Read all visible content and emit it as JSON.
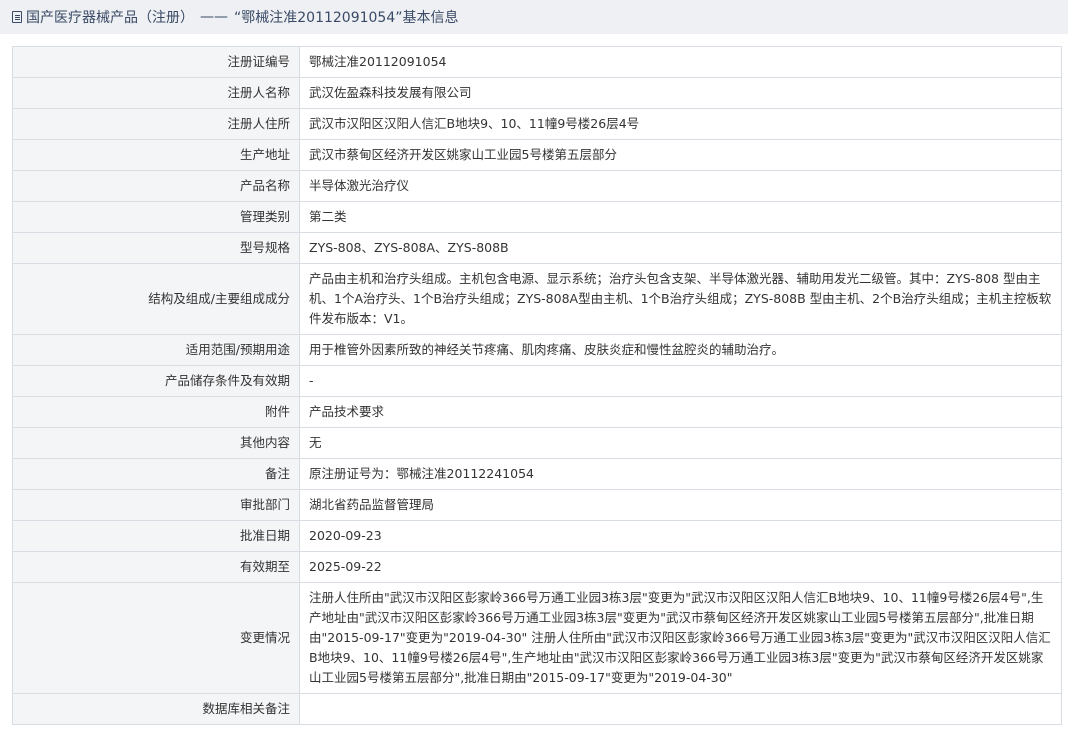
{
  "page": {
    "title_prefix": "国产医疗器械产品（注册）",
    "separator": "——",
    "title_main": "“鄂械注准20112091054”基本信息",
    "icon": "document-icon"
  },
  "rows": [
    {
      "label": "注册证编号",
      "value": "鄂械注准20112091054"
    },
    {
      "label": "注册人名称",
      "value": "武汉佐盈森科技发展有限公司"
    },
    {
      "label": "注册人住所",
      "value": "武汉市汉阳区汉阳人信汇B地块9、10、11幢9号楼26层4号"
    },
    {
      "label": "生产地址",
      "value": "武汉市蔡甸区经济开发区姚家山工业园5号楼第五层部分"
    },
    {
      "label": "产品名称",
      "value": "半导体激光治疗仪"
    },
    {
      "label": "管理类别",
      "value": "第二类"
    },
    {
      "label": "型号规格",
      "value": "ZYS-808、ZYS-808A、ZYS-808B"
    },
    {
      "label": "结构及组成/主要组成成分",
      "value": "产品由主机和治疗头组成。主机包含电源、显示系统；治疗头包含支架、半导体激光器、辅助用发光二级管。其中：ZYS-808 型由主机、1个A治疗头、1个B治疗头组成；ZYS-808A型由主机、1个B治疗头组成；ZYS-808B 型由主机、2个B治疗头组成；主机主控板软件发布版本：V1。"
    },
    {
      "label": "适用范围/预期用途",
      "value": "用于椎管外因素所致的神经关节疼痛、肌肉疼痛、皮肤炎症和慢性盆腔炎的辅助治疗。"
    },
    {
      "label": "产品储存条件及有效期",
      "value": "-"
    },
    {
      "label": "附件",
      "value": "产品技术要求"
    },
    {
      "label": "其他内容",
      "value": "无"
    },
    {
      "label": "备注",
      "value": "原注册证号为：鄂械注准20112241054"
    },
    {
      "label": "审批部门",
      "value": "湖北省药品监督管理局"
    },
    {
      "label": "批准日期",
      "value": "2020-09-23"
    },
    {
      "label": "有效期至",
      "value": "2025-09-22"
    },
    {
      "label": "变更情况",
      "value": "注册人住所由\"武汉市汉阳区彭家岭366号万通工业园3栋3层\"变更为\"武汉市汉阳区汉阳人信汇B地块9、10、11幢9号楼26层4号\",生产地址由\"武汉市汉阳区彭家岭366号万通工业园3栋3层\"变更为\"武汉市蔡甸区经济开发区姚家山工业园5号楼第五层部分\",批准日期由\"2015-09-17\"变更为\"2019-04-30\" 注册人住所由\"武汉市汉阳区彭家岭366号万通工业园3栋3层\"变更为\"武汉市汉阳区汉阳人信汇B地块9、10、11幢9号楼26层4号\",生产地址由\"武汉市汉阳区彭家岭366号万通工业园3栋3层\"变更为\"武汉市蔡甸区经济开发区姚家山工业园5号楼第五层部分\",批准日期由\"2015-09-17\"变更为\"2019-04-30\""
    },
    {
      "label": "数据库相关备注",
      "value": ""
    }
  ]
}
